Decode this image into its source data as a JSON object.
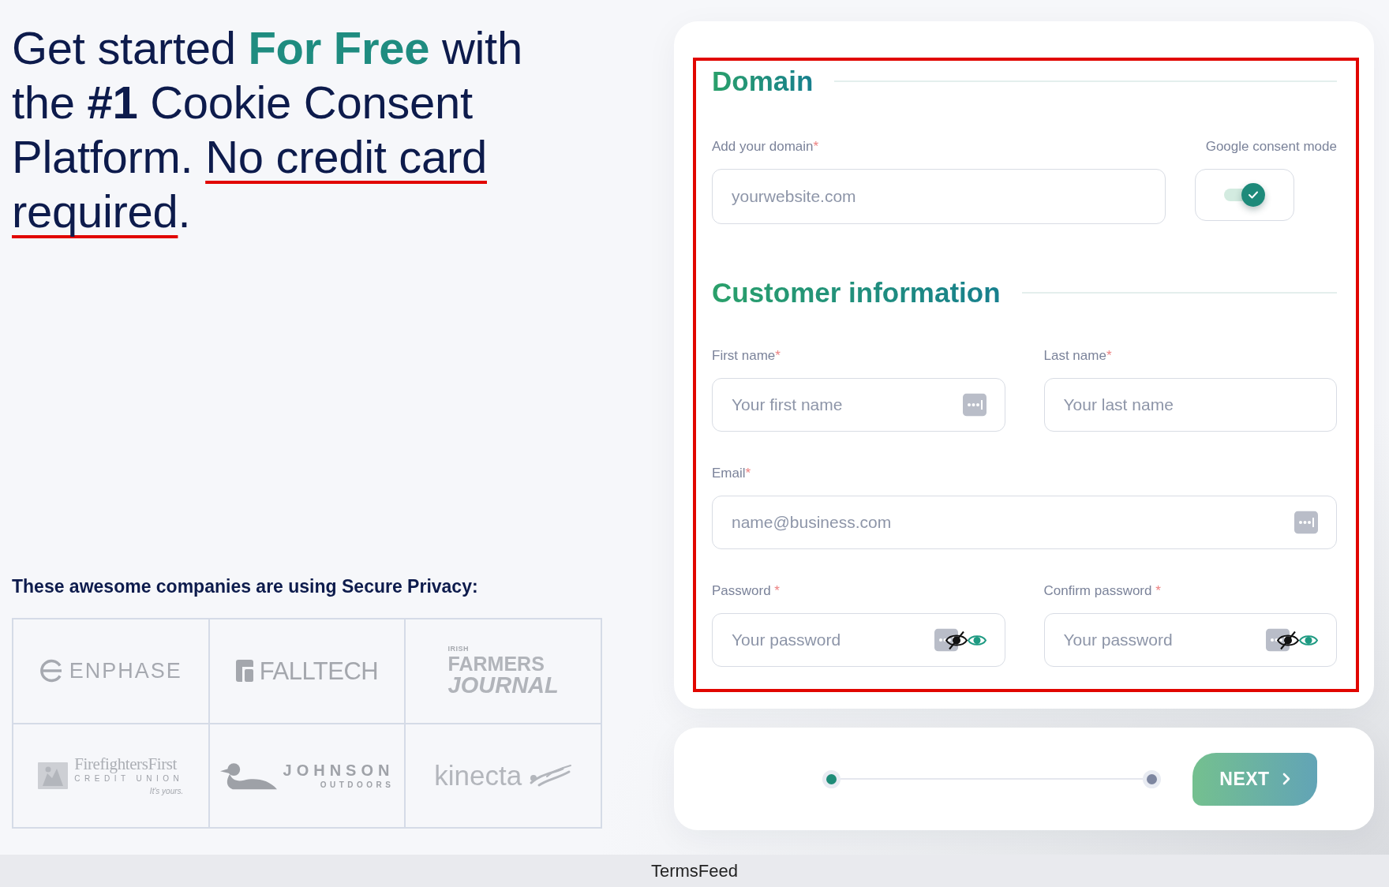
{
  "headline": [
    {
      "text": "Get started ",
      "kind": "plain"
    },
    {
      "text": "For Free",
      "kind": "accent"
    },
    {
      "text": " with the ",
      "kind": "plain"
    },
    {
      "text": "#1",
      "kind": "strong"
    },
    {
      "text": " Cookie Consent Platform. ",
      "kind": "plain"
    },
    {
      "text": "No credit card required",
      "kind": "underline"
    },
    {
      "text": ".",
      "kind": "plain"
    }
  ],
  "clients": {
    "title": "These awesome companies are using Secure Privacy:",
    "logos": [
      {
        "kind": "ring_mark",
        "lines": [
          "ENPHASE"
        ]
      },
      {
        "kind": "tile_mark",
        "lines": [
          "FALLTECH"
        ]
      },
      {
        "kind": "text_only",
        "lines": [
          "IRISH",
          "FARMERS",
          "JOURNAL"
        ]
      },
      {
        "kind": "badge_mark",
        "lines": [
          "FirefightersFirst",
          "CREDIT UNION",
          "It's yours."
        ]
      },
      {
        "kind": "bird_mark",
        "lines": [
          "JOHNSON",
          "OUTDOORS"
        ]
      },
      {
        "kind": "swirl_mark",
        "lines": [
          "kinecta"
        ]
      }
    ]
  },
  "form": {
    "domain_section": {
      "title": "Domain",
      "domain_field": {
        "label": "Add your domain",
        "required_mark": "*",
        "placeholder": "yourwebsite.com"
      },
      "google_consent": {
        "label": "Google consent mode",
        "on": true
      }
    },
    "customer_section": {
      "title": "Customer information",
      "rows": [
        {
          "fields": [
            {
              "kind": "text",
              "label": "First name",
              "required_mark": "*",
              "placeholder": "Your first name",
              "autofill": true
            },
            {
              "kind": "text",
              "label": "Last name",
              "required_mark": "*",
              "placeholder": "Your last name",
              "autofill": false
            }
          ]
        },
        {
          "fields": [
            {
              "kind": "email",
              "label": "Email",
              "required_mark": "*",
              "placeholder": "name@business.com",
              "autofill": true
            }
          ]
        },
        {
          "fields": [
            {
              "kind": "password",
              "label": "Password",
              "required_mark": " *",
              "placeholder": "Your password",
              "autofill": true
            },
            {
              "kind": "password",
              "label": "Confirm password",
              "required_mark": " *",
              "placeholder": "Your password",
              "autofill": true
            }
          ]
        }
      ]
    }
  },
  "wizard": {
    "steps": [
      {
        "active": true
      },
      {
        "active": false
      }
    ],
    "next_button": {
      "label": "NEXT"
    }
  },
  "footer": {
    "caption": "TermsFeed"
  }
}
